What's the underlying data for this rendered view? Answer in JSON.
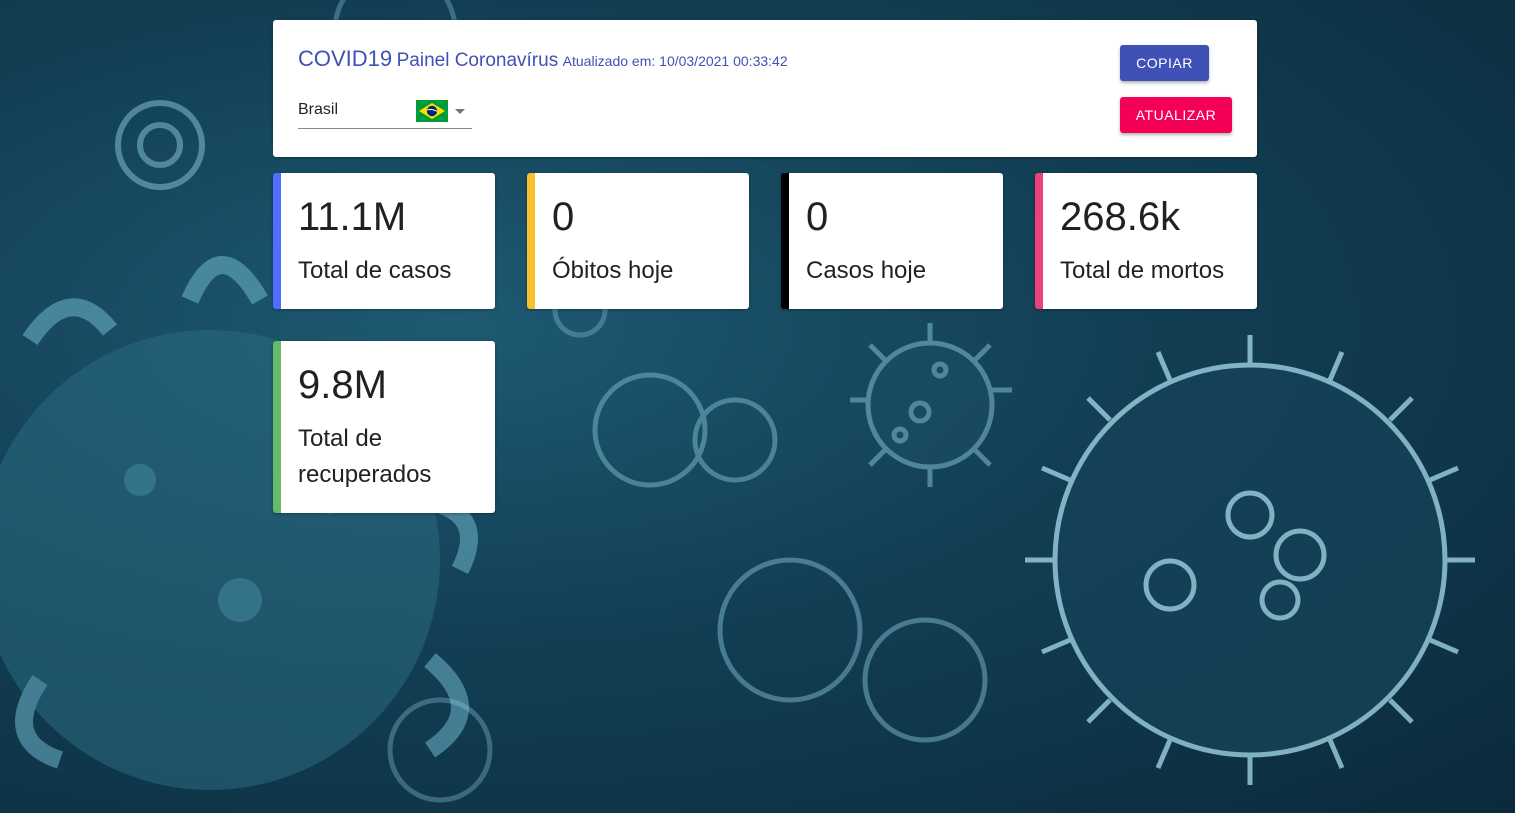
{
  "header": {
    "title_main": "COVID19",
    "title_sub": "Painel Coronavírus",
    "updated": "Atualizado em: 10/03/2021 00:33:42",
    "country": "Brasil",
    "flag_icon": "brazil-flag-icon",
    "copy_label": "COPIAR",
    "update_label": "ATUALIZAR"
  },
  "stats": [
    {
      "value": "11.1M",
      "label": "Total de casos",
      "accent": "#536dfe"
    },
    {
      "value": "0",
      "label": "Óbitos hoje",
      "accent": "#fbc02d"
    },
    {
      "value": "0",
      "label": "Casos hoje",
      "accent": "#000000"
    },
    {
      "value": "268.6k",
      "label": "Total de mortos",
      "accent": "#ec407a"
    },
    {
      "value": "9.8M",
      "label": "Total de recuperados",
      "accent": "#66bb6a"
    }
  ],
  "colors": {
    "primary": "#3f51b5",
    "secondary": "#f50057",
    "background": "#123f55"
  }
}
